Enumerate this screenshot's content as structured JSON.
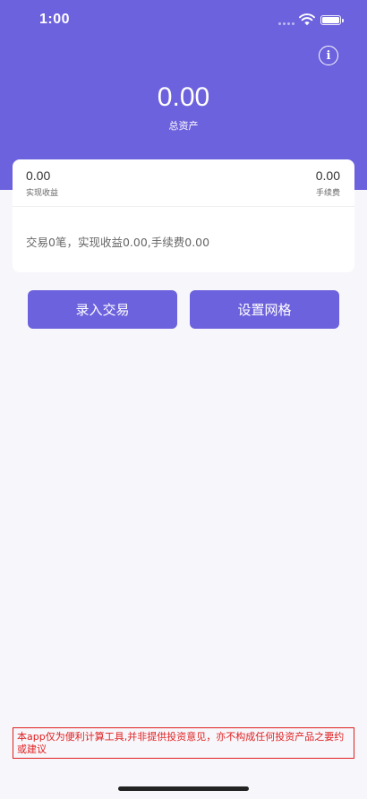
{
  "status_bar": {
    "time": "1:00",
    "icons": [
      "cellular-dots-icon",
      "wifi-icon",
      "battery-icon"
    ]
  },
  "header": {
    "info_icon": "info-icon",
    "info_glyph": "i",
    "total_value": "0.00",
    "total_label": "总资产"
  },
  "stats": {
    "realized_profit": {
      "value": "0.00",
      "label": "实现收益"
    },
    "fees": {
      "value": "0.00",
      "label": "手续费"
    },
    "summary": "交易0笔，实现收益0.00,手续费0.00"
  },
  "actions": {
    "record_trade": "录入交易",
    "set_grid": "设置网格"
  },
  "disclaimer": "本app仅为便利计算工具,并非提供投资意见，亦不构成任何投资产品之要约或建议",
  "colors": {
    "brand": "#6d62dd",
    "warning": "#e02020",
    "background": "#f7f7fb"
  }
}
